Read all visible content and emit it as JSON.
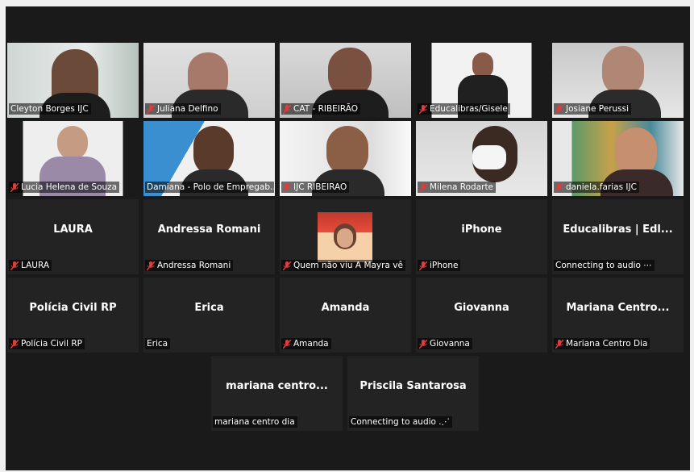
{
  "colors": {
    "active_speaker": "#9acd32",
    "muted": "#e03c3c",
    "tile_bg": "#232323"
  },
  "tiles": [
    {
      "label": "Cleyton Borges IJC",
      "muted": false,
      "active": true
    },
    {
      "label": "Juliana Delfino",
      "muted": true
    },
    {
      "label": "CAT - RIBEIRÃO",
      "muted": true
    },
    {
      "label": "Educalibras/Gisele",
      "muted": true
    },
    {
      "label": "Josiane Perussi",
      "muted": true
    },
    {
      "label": "Lucia Helena de Souza",
      "muted": true
    },
    {
      "label": "Damiana - Polo de Empregab...",
      "muted": false
    },
    {
      "label": "IJC RIBEIRAO",
      "muted": true
    },
    {
      "label": "Milena Rodarte",
      "muted": true
    },
    {
      "label": "daniela.farias IJC",
      "muted": true
    },
    {
      "name": "LAURA",
      "label": "LAURA",
      "muted": true
    },
    {
      "name": "Andressa Romani",
      "label": "Andressa Romani",
      "muted": true
    },
    {
      "label": "Quem não viu A Mayra vê",
      "muted": true
    },
    {
      "name": "iPhone",
      "label": "iPhone",
      "muted": true
    },
    {
      "name": "Educalibras | Edl...",
      "label": "Connecting to audio ⋯",
      "muted": false
    },
    {
      "name": "Polícia Civil RP",
      "label": "Polícia Civil RP",
      "muted": true
    },
    {
      "name": "Erica",
      "label": "Erica",
      "muted": false
    },
    {
      "name": "Amanda",
      "label": "Amanda",
      "muted": true
    },
    {
      "name": "Giovanna",
      "label": "Giovanna",
      "muted": true
    },
    {
      "name": "Mariana  Centro...",
      "label": "Mariana Centro Dia",
      "muted": true
    },
    {
      "name": "mariana  centro...",
      "label": "mariana centro dia",
      "muted": false
    },
    {
      "name": "Priscila Santarosa",
      "label": "Connecting to audio .⋰",
      "muted": false
    }
  ]
}
